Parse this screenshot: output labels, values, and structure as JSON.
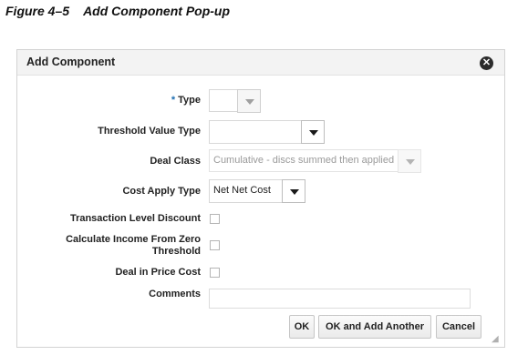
{
  "figure_caption": "Figure 4–5    Add Component Pop-up",
  "dialog": {
    "title": "Add Component",
    "close_icon": "close-circle-icon"
  },
  "form": {
    "type": {
      "label": "Type",
      "required_marker": "*",
      "value": ""
    },
    "threshold_value_type": {
      "label": "Threshold Value Type",
      "value": ""
    },
    "deal_class": {
      "label": "Deal Class",
      "value": "Cumulative - discs summed then applied",
      "disabled": true
    },
    "cost_apply_type": {
      "label": "Cost Apply Type",
      "value": "Net Net Cost"
    },
    "transaction_level_discount": {
      "label": "Transaction Level Discount",
      "checked": false
    },
    "calculate_income_from_zero_threshold": {
      "label_line1": "Calculate Income From Zero",
      "label_line2": "Threshold",
      "checked": false
    },
    "deal_in_price_cost": {
      "label": "Deal in Price Cost",
      "checked": false
    },
    "comments": {
      "label": "Comments",
      "value": ""
    }
  },
  "buttons": {
    "ok": "OK",
    "ok_and_add_another": "OK and Add Another",
    "cancel": "Cancel"
  },
  "colors": {
    "required_marker": "#1f6fb2",
    "header_background": "#f3f3f3"
  }
}
